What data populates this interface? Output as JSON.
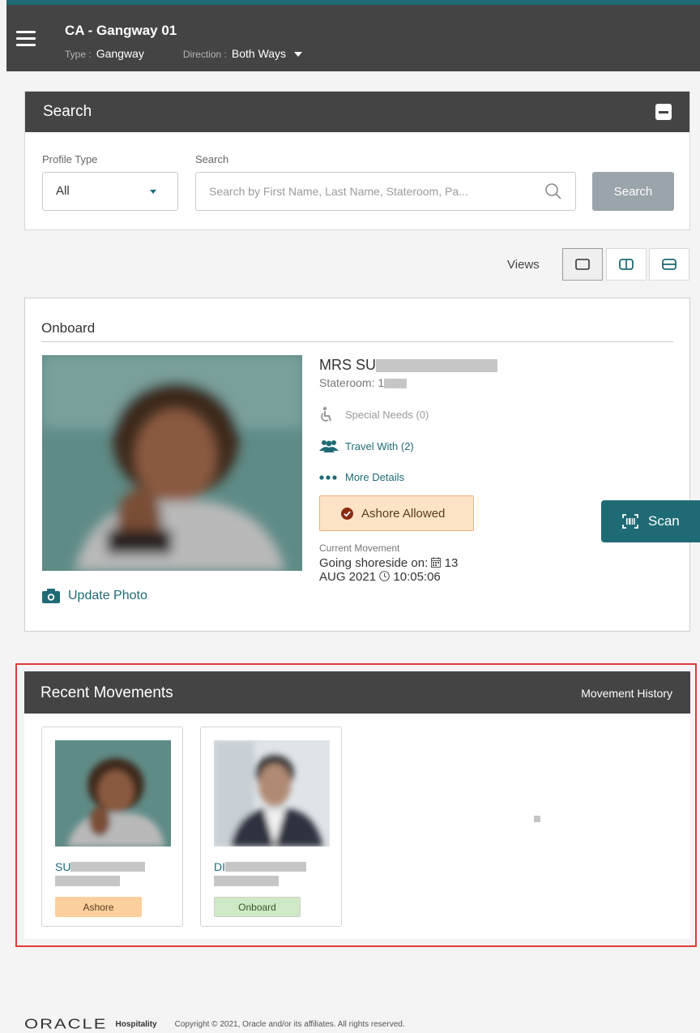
{
  "header": {
    "title": "CA - Gangway 01",
    "type_label": "Type :",
    "type_value": "Gangway",
    "direction_label": "Direction :",
    "direction_value": "Both Ways"
  },
  "search": {
    "panel_title": "Search",
    "profile_type_label": "Profile Type",
    "profile_type_value": "All",
    "search_label": "Search",
    "search_placeholder": "Search by First Name, Last Name, Stateroom, Pa...",
    "search_button": "Search"
  },
  "views": {
    "label": "Views"
  },
  "onboard": {
    "section_title": "Onboard",
    "guest_name_prefix": "MRS SU",
    "stateroom_prefix": "Stateroom: 1",
    "special_needs": "Special Needs (0)",
    "travel_with": "Travel With (2)",
    "more_details": "More Details",
    "status": "Ashore Allowed",
    "current_movement_label": "Current Movement",
    "movement_text": "Going shoreside on:",
    "movement_date_day": "13",
    "movement_date_rest": "AUG 2021",
    "movement_time": "10:05:06",
    "update_photo": "Update Photo"
  },
  "scan_button": "Scan",
  "recent_movements": {
    "title": "Recent Movements",
    "history_link": "Movement History",
    "cards": [
      {
        "name_prefix": "SU",
        "status": "Ashore"
      },
      {
        "name_prefix": "DI",
        "status": "Onboard"
      }
    ]
  },
  "footer": {
    "logo": "ORACLE",
    "logo_sub": "Hospitality",
    "copyright": "Copyright © 2021, Oracle and/or its affiliates. All rights reserved."
  },
  "colors": {
    "header_bg": "#444444",
    "accent": "#1f6b75",
    "ashore": "#fbd09e",
    "onboard": "#cfe8c6",
    "highlight": "#e23b3b"
  }
}
